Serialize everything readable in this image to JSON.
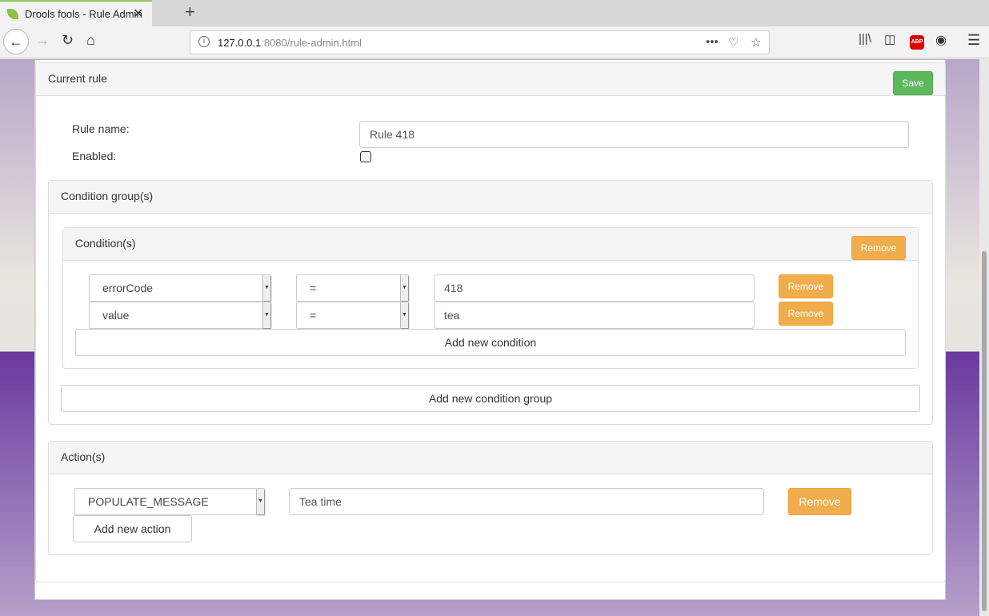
{
  "browser": {
    "tab_title": "Drools fools - Rule Admin",
    "url_host": "127.0.0.1",
    "url_rest": ":8080/rule-admin.html"
  },
  "rule": {
    "header": "Current rule",
    "save": "Save",
    "name_label": "Rule name:",
    "name_value": "Rule 418",
    "enabled_label": "Enabled:",
    "enabled": false
  },
  "condition_groups": {
    "header": "Condition group(s)",
    "add_group": "Add new condition group",
    "groups": [
      {
        "header": "Condition(s)",
        "remove": "Remove",
        "add_condition": "Add new condition",
        "conditions": [
          {
            "field": "errorCode",
            "operator": "=",
            "value": "418",
            "remove": "Remove"
          },
          {
            "field": "value",
            "operator": "=",
            "value": "tea",
            "remove": "Remove"
          }
        ]
      }
    ]
  },
  "actions": {
    "header": "Action(s)",
    "add_action": "Add new action",
    "items": [
      {
        "type": "POPULATE_MESSAGE",
        "value": "Tea time",
        "remove": "Remove"
      }
    ]
  },
  "colors": {
    "save": "#5cb85c",
    "remove": "#f0ad4e"
  }
}
